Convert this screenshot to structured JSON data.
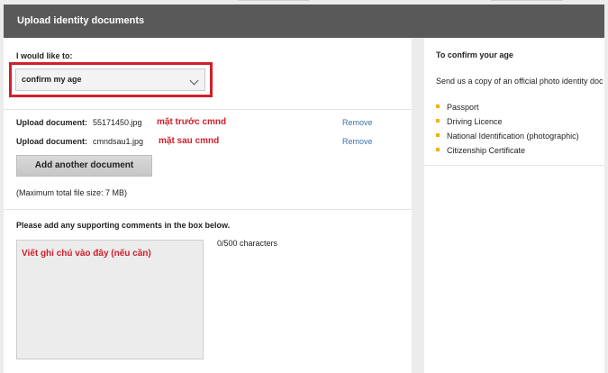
{
  "header": {
    "title": "Upload identity documents"
  },
  "form": {
    "intent_label": "I would like to:",
    "intent_value": "confirm my age",
    "uploads": [
      {
        "label": "Upload document:",
        "filename": "55171450.jpg",
        "note": "mặt trước cmnd",
        "remove": "Remove"
      },
      {
        "label": "Upload document:",
        "filename": "cmndsau1.jpg",
        "note": "mặt sau cmnd",
        "remove": "Remove"
      }
    ],
    "add_button": "Add another document",
    "max_size": "(Maximum total file size: 7 MB)",
    "comments_label": "Please add any supporting comments in the box below.",
    "comments_value": "Viết ghi chú vào đây (nếu cần)",
    "char_count": "0/500 characters"
  },
  "sidebar": {
    "title": "To confirm your age",
    "description": "Send us a copy of an official photo identity doc",
    "documents": [
      "Passport",
      "Driving Licence",
      "National Identification (photographic)",
      "Citizenship Certificate"
    ]
  },
  "colors": {
    "header_bg": "#595959",
    "annotation_red": "#d0202b",
    "link": "#3a6fb0",
    "bullet": "#f0b400"
  }
}
